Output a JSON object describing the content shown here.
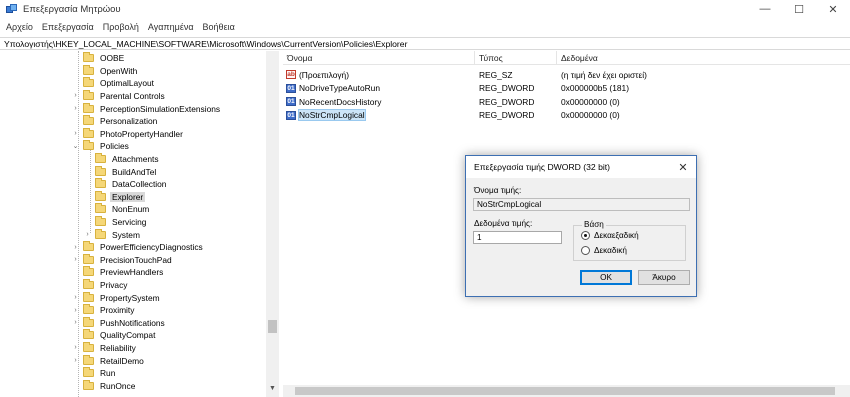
{
  "window": {
    "title": "Επεξεργασία Μητρώου",
    "controls": {
      "minimize": "—",
      "maximize": "☐",
      "close": "✕"
    }
  },
  "menu": [
    "Αρχείο",
    "Επεξεργασία",
    "Προβολή",
    "Αγαπημένα",
    "Βοήθεια"
  ],
  "address": "Υπολογιστής\\HKEY_LOCAL_MACHINE\\SOFTWARE\\Microsoft\\Windows\\CurrentVersion\\Policies\\Explorer",
  "tree": [
    {
      "label": "OOBE",
      "level": 0,
      "expander": ""
    },
    {
      "label": "OpenWith",
      "level": 0,
      "expander": ""
    },
    {
      "label": "OptimalLayout",
      "level": 0,
      "expander": ""
    },
    {
      "label": "Parental Controls",
      "level": 0,
      "expander": "›"
    },
    {
      "label": "PerceptionSimulationExtensions",
      "level": 0,
      "expander": "›"
    },
    {
      "label": "Personalization",
      "level": 0,
      "expander": ""
    },
    {
      "label": "PhotoPropertyHandler",
      "level": 0,
      "expander": "›"
    },
    {
      "label": "Policies",
      "level": 0,
      "expander": "⌄"
    },
    {
      "label": "Attachments",
      "level": 1,
      "expander": ""
    },
    {
      "label": "BuildAndTel",
      "level": 1,
      "expander": ""
    },
    {
      "label": "DataCollection",
      "level": 1,
      "expander": ""
    },
    {
      "label": "Explorer",
      "level": 1,
      "expander": "",
      "selected": true
    },
    {
      "label": "NonEnum",
      "level": 1,
      "expander": ""
    },
    {
      "label": "Servicing",
      "level": 1,
      "expander": ""
    },
    {
      "label": "System",
      "level": 1,
      "expander": "›"
    },
    {
      "label": "PowerEfficiencyDiagnostics",
      "level": 0,
      "expander": "›"
    },
    {
      "label": "PrecisionTouchPad",
      "level": 0,
      "expander": "›"
    },
    {
      "label": "PreviewHandlers",
      "level": 0,
      "expander": ""
    },
    {
      "label": "Privacy",
      "level": 0,
      "expander": ""
    },
    {
      "label": "PropertySystem",
      "level": 0,
      "expander": "›"
    },
    {
      "label": "Proximity",
      "level": 0,
      "expander": "›"
    },
    {
      "label": "PushNotifications",
      "level": 0,
      "expander": "›"
    },
    {
      "label": "QualityCompat",
      "level": 0,
      "expander": ""
    },
    {
      "label": "Reliability",
      "level": 0,
      "expander": "›"
    },
    {
      "label": "RetailDemo",
      "level": 0,
      "expander": "›"
    },
    {
      "label": "Run",
      "level": 0,
      "expander": ""
    },
    {
      "label": "RunOnce",
      "level": 0,
      "expander": ""
    }
  ],
  "values": {
    "headers": {
      "name": "Όνομα",
      "type": "Τύπος",
      "data": "Δεδομένα"
    },
    "rows": [
      {
        "icon": "string-value-icon",
        "glyph": "ab",
        "name": "(Προεπιλογή)",
        "type": "REG_SZ",
        "data": "(η τιμή δεν έχει οριστεί)"
      },
      {
        "icon": "dword-value-icon",
        "glyph": "01",
        "name": "NoDriveTypeAutoRun",
        "type": "REG_DWORD",
        "data": "0x000000b5 (181)"
      },
      {
        "icon": "dword-value-icon",
        "glyph": "01",
        "name": "NoRecentDocsHistory",
        "type": "REG_DWORD",
        "data": "0x00000000 (0)"
      },
      {
        "icon": "dword-value-icon",
        "glyph": "01",
        "name": "NoStrCmpLogical",
        "type": "REG_DWORD",
        "data": "0x00000000 (0)",
        "selected": true
      }
    ]
  },
  "dialog": {
    "title": "Επεξεργασία τιμής DWORD (32 bit)",
    "close": "✕",
    "name_label": "Όνομα τιμής:",
    "name_value": "NoStrCmpLogical",
    "data_label": "Δεδομένα τιμής:",
    "data_value": "1",
    "base_label": "Βάση",
    "base_options": [
      "Δεκαεξαδική",
      "Δεκαδική"
    ],
    "base_selected": "Δεκαεξαδική",
    "ok": "OK",
    "cancel": "Άκυρο"
  },
  "colors": {
    "selection": "#cce4f7",
    "folder": "#f5d778",
    "dialog_border": "#3d6fb2",
    "ok_border": "#0078d7"
  }
}
